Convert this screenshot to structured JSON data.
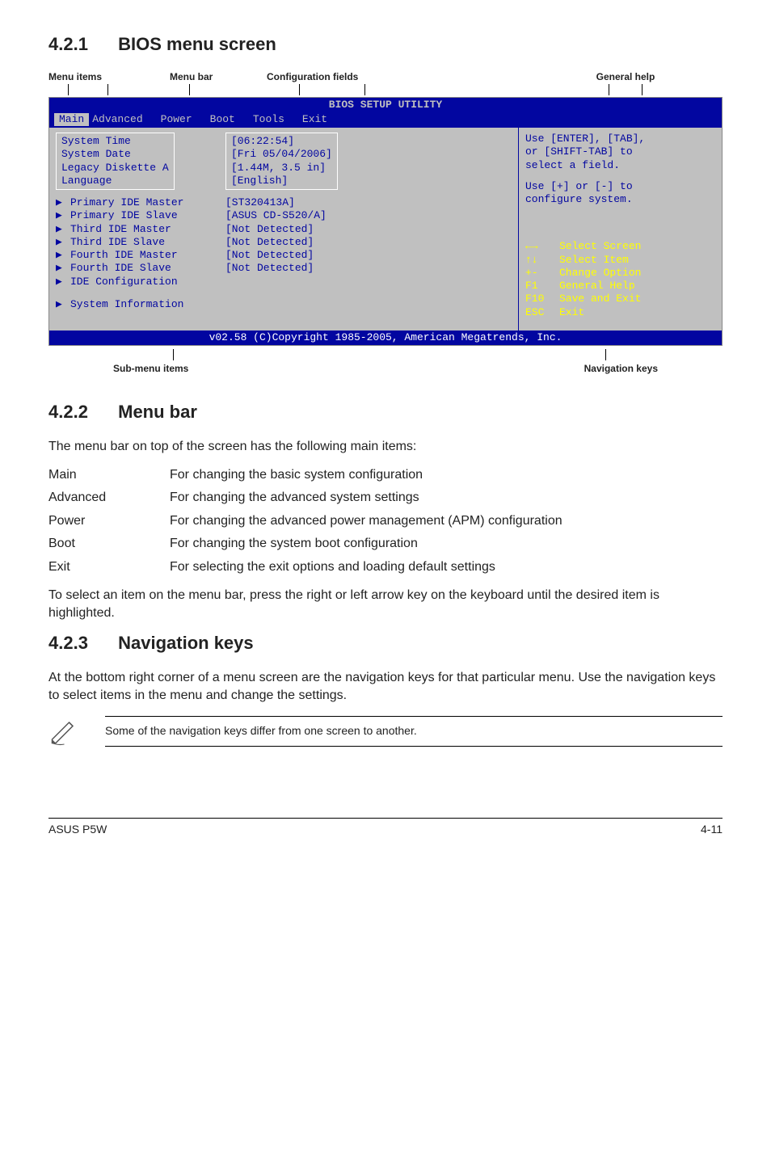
{
  "sections": {
    "s1": {
      "num": "4.2.1",
      "title": "BIOS menu screen"
    },
    "s2": {
      "num": "4.2.2",
      "title": "Menu bar"
    },
    "s3": {
      "num": "4.2.3",
      "title": "Navigation keys"
    }
  },
  "diagram_labels": {
    "menu_items": "Menu items",
    "menu_bar": "Menu bar",
    "config_fields": "Configuration fields",
    "general_help": "General help",
    "sub_menu": "Sub-menu items",
    "nav_keys": "Navigation keys"
  },
  "bios": {
    "title": "BIOS SETUP UTILITY",
    "tabs": {
      "main": "Main",
      "advanced": "Advanced",
      "power": "Power",
      "boot": "Boot",
      "tools": "Tools",
      "exit": "Exit"
    },
    "left": {
      "system_time": {
        "label": "System Time",
        "value": "[06:22:54]"
      },
      "system_date": {
        "label": "System Date",
        "value": "[Fri 05/04/2006]"
      },
      "legacy": {
        "label": "Legacy Diskette A",
        "value": "[1.44M, 3.5 in]"
      },
      "language": {
        "label": "Language",
        "value": "[English]"
      },
      "pim": {
        "label": "Primary IDE Master",
        "value": "[ST320413A]"
      },
      "pis": {
        "label": "Primary IDE Slave",
        "value": "[ASUS CD-S520/A]"
      },
      "tim": {
        "label": "Third IDE Master",
        "value": "[Not Detected]"
      },
      "tis": {
        "label": "Third IDE Slave",
        "value": "[Not Detected]"
      },
      "fim": {
        "label": "Fourth IDE Master",
        "value": "[Not Detected]"
      },
      "fis": {
        "label": "Fourth IDE Slave",
        "value": "[Not Detected]"
      },
      "idec": {
        "label": "IDE Configuration"
      },
      "sysinfo": {
        "label": "System Information"
      }
    },
    "help": {
      "l1": "Use [ENTER], [TAB],",
      "l2": "or [SHIFT-TAB] to",
      "l3": "select a field.",
      "l4": "Use [+] or [-] to",
      "l5": "configure system."
    },
    "nav": {
      "r1": {
        "k": "←→",
        "t": "Select Screen"
      },
      "r2": {
        "k": "↑↓",
        "t": "Select Item"
      },
      "r3": {
        "k": "+-",
        "t": "Change Option"
      },
      "r4": {
        "k": "F1",
        "t": "General Help"
      },
      "r5": {
        "k": "F10",
        "t": "Save and Exit"
      },
      "r6": {
        "k": "ESC",
        "t": "Exit"
      }
    },
    "footer": "v02.58 (C)Copyright 1985-2005, American Megatrends, Inc."
  },
  "menubar_intro": "The menu bar on top of the screen has the following main items:",
  "menubar_table": {
    "main": {
      "k": "Main",
      "v": "For changing the basic system configuration"
    },
    "advanced": {
      "k": "Advanced",
      "v": "For changing the advanced system settings"
    },
    "power": {
      "k": "Power",
      "v": "For changing the advanced power management (APM) configuration"
    },
    "boot": {
      "k": "Boot",
      "v": "For changing the system boot configuration"
    },
    "exit": {
      "k": "Exit",
      "v": "For selecting the exit options and loading default settings"
    }
  },
  "menubar_outro": "To select an item on the menu bar, press the right or left arrow key on the keyboard until the desired item is highlighted.",
  "nav_section": {
    "para": "At the bottom right corner of a menu screen are the navigation keys for that particular menu. Use the navigation keys to select items in the menu and change the settings.",
    "note": "Some of the navigation keys differ from one screen to another."
  },
  "footer": {
    "left": "ASUS P5W",
    "right": "4-11"
  }
}
